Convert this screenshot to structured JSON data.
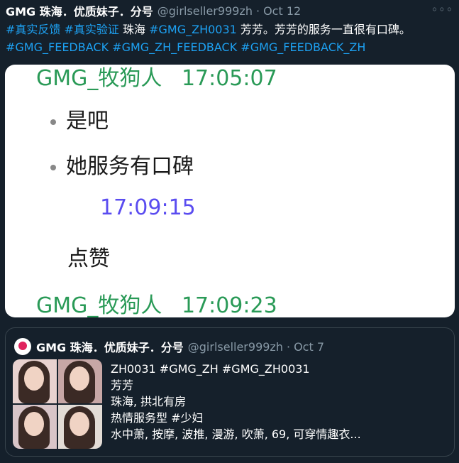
{
  "tweet": {
    "author_name": "GMG 珠海．优质妹子．分号",
    "handle": "@girlseller999zh",
    "separator": "·",
    "date": "Oct 12",
    "more_icon": "more-horizontal-icon",
    "more_glyph": "◦◦◦",
    "text_parts": [
      {
        "text": "#真实反馈",
        "type": "tag"
      },
      {
        "text": " ",
        "type": "plain"
      },
      {
        "text": "#真实验证",
        "type": "tag"
      },
      {
        "text": " 珠海 ",
        "type": "plain"
      },
      {
        "text": "#GMG_ZH0031",
        "type": "tag"
      },
      {
        "text": " 芳芳。芳芳的服务一直很有口碑。",
        "type": "plain"
      },
      {
        "text": "#GMG_FEEDBACK",
        "type": "tag"
      },
      {
        "text": " ",
        "type": "plain"
      },
      {
        "text": "#GMG_ZH_FEEDBACK",
        "type": "tag"
      },
      {
        "text": " ",
        "type": "plain"
      },
      {
        "text": "#GMG_FEEDBACK_ZH",
        "type": "tag"
      }
    ]
  },
  "media": {
    "line1_sender": "GMG_牧狗人",
    "line1_time": "17:05:07",
    "msg1": "是吧",
    "msg2": "她服务有口碑",
    "time2": "17:09:15",
    "msg3": "点赞",
    "line_last_sender": "GMG_牧狗人",
    "line_last_time": "17:09:23"
  },
  "quoted": {
    "avatar_icon": "brand-logo-icon",
    "author_name": "GMG 珠海．优质妹子．分号",
    "handle": "@girlseller999zh",
    "separator": "·",
    "date": "Oct 7",
    "lines": [
      "ZH0031 #GMG_ZH #GMG_ZH0031",
      "芳芳",
      "珠海, 拱北有房",
      "热情服务型 #少妇",
      "水中萧, 按摩, 波推, 漫游, 吹萧, 69, 可穿情趣衣..."
    ]
  },
  "colors": {
    "background": "#15202b",
    "link": "#1da1f2",
    "muted": "#8899a6",
    "chat_green": "#2a9a57",
    "chat_blue": "#5a4cf0"
  }
}
